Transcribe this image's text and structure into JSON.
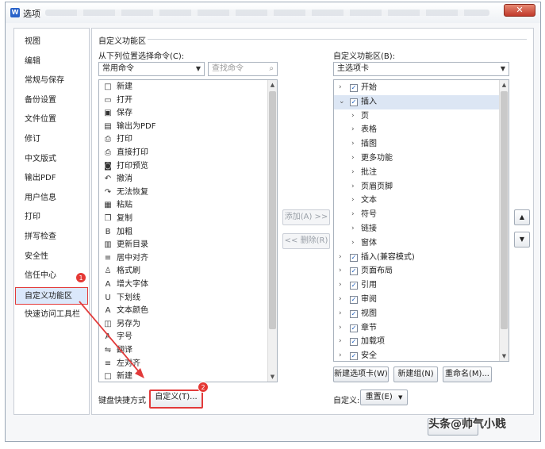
{
  "window": {
    "title": "选项",
    "close_label": "✕"
  },
  "sidebar": {
    "items": [
      "视图",
      "编辑",
      "常规与保存",
      "备份设置",
      "文件位置",
      "修订",
      "中文版式",
      "输出PDF",
      "用户信息",
      "打印",
      "拼写检查",
      "安全性",
      "信任中心",
      "自定义功能区",
      "快速访问工具栏"
    ],
    "active_index": 13
  },
  "main": {
    "section_title": "自定义功能区",
    "left_label": "从下列位置选择命令(C):",
    "left_combo": "常用命令",
    "search_placeholder": "查找命令",
    "commands": [
      {
        "label": "新建",
        "icon": "□"
      },
      {
        "label": "打开",
        "icon": "▭"
      },
      {
        "label": "保存",
        "icon": "▣"
      },
      {
        "label": "输出为PDF",
        "icon": "▤"
      },
      {
        "label": "打印",
        "icon": "⎙"
      },
      {
        "label": "直接打印",
        "icon": "⎙"
      },
      {
        "label": "打印预览",
        "icon": "◙"
      },
      {
        "label": "撤消",
        "icon": "↶"
      },
      {
        "label": "无法恢复",
        "icon": "↷"
      },
      {
        "label": "粘贴",
        "icon": "▦"
      },
      {
        "label": "复制",
        "icon": "❐"
      },
      {
        "label": "加粗",
        "icon": "B"
      },
      {
        "label": "更新目录",
        "icon": "▥"
      },
      {
        "label": "居中对齐",
        "icon": "≡"
      },
      {
        "label": "格式刷",
        "icon": "♙"
      },
      {
        "label": "增大字体",
        "icon": "A"
      },
      {
        "label": "下划线",
        "icon": "U"
      },
      {
        "label": "文本颜色",
        "icon": "A"
      },
      {
        "label": "另存为",
        "icon": "◫"
      },
      {
        "label": "字号",
        "icon": "A"
      },
      {
        "label": "翻译",
        "icon": "⇋"
      },
      {
        "label": "左对齐",
        "icon": "≡"
      },
      {
        "label": "新建",
        "icon": "□"
      }
    ],
    "add_button": "添加(A) >>",
    "remove_button": "<< 删除(R)",
    "right_label": "自定义功能区(B):",
    "right_combo": "主选项卡",
    "tree": [
      {
        "label": "开始",
        "level": 0,
        "twisty": "›",
        "checked": true
      },
      {
        "label": "插入",
        "level": 0,
        "twisty": "⌄",
        "checked": true,
        "selected": true
      },
      {
        "label": "页",
        "level": 1,
        "twisty": "›"
      },
      {
        "label": "表格",
        "level": 1,
        "twisty": "›"
      },
      {
        "label": "插图",
        "level": 1,
        "twisty": "›"
      },
      {
        "label": "更多功能",
        "level": 1,
        "twisty": "›"
      },
      {
        "label": "批注",
        "level": 1,
        "twisty": "›"
      },
      {
        "label": "页眉页脚",
        "level": 1,
        "twisty": "›"
      },
      {
        "label": "文本",
        "level": 1,
        "twisty": "›"
      },
      {
        "label": "符号",
        "level": 1,
        "twisty": "›"
      },
      {
        "label": "链接",
        "level": 1,
        "twisty": "›"
      },
      {
        "label": "窗体",
        "level": 1,
        "twisty": "›"
      },
      {
        "label": "插入(兼容模式)",
        "level": 0,
        "twisty": "›",
        "checked": true
      },
      {
        "label": "页面布局",
        "level": 0,
        "twisty": "›",
        "checked": true
      },
      {
        "label": "引用",
        "level": 0,
        "twisty": "›",
        "checked": true
      },
      {
        "label": "审阅",
        "level": 0,
        "twisty": "›",
        "checked": true
      },
      {
        "label": "视图",
        "level": 0,
        "twisty": "›",
        "checked": true
      },
      {
        "label": "章节",
        "level": 0,
        "twisty": "›",
        "checked": true
      },
      {
        "label": "加载项",
        "level": 0,
        "twisty": "›",
        "checked": true
      },
      {
        "label": "安全",
        "level": 0,
        "twisty": "›",
        "checked": true
      }
    ],
    "new_tab_button": "新建选项卡(W)",
    "new_group_button": "新建组(N)",
    "rename_button": "重命名(M)...",
    "shortcut_label": "键盘快捷方式",
    "customize_button": "自定义(T)...",
    "customize_label": "自定义:",
    "reset_button": "重置(E)",
    "move_up": "▲",
    "move_down": "▼"
  },
  "badges": [
    "1",
    "2"
  ],
  "watermark": "头条@帅气小贱",
  "accent": {
    "highlight": "#e23a3a",
    "selection": "#dbe8fb"
  }
}
